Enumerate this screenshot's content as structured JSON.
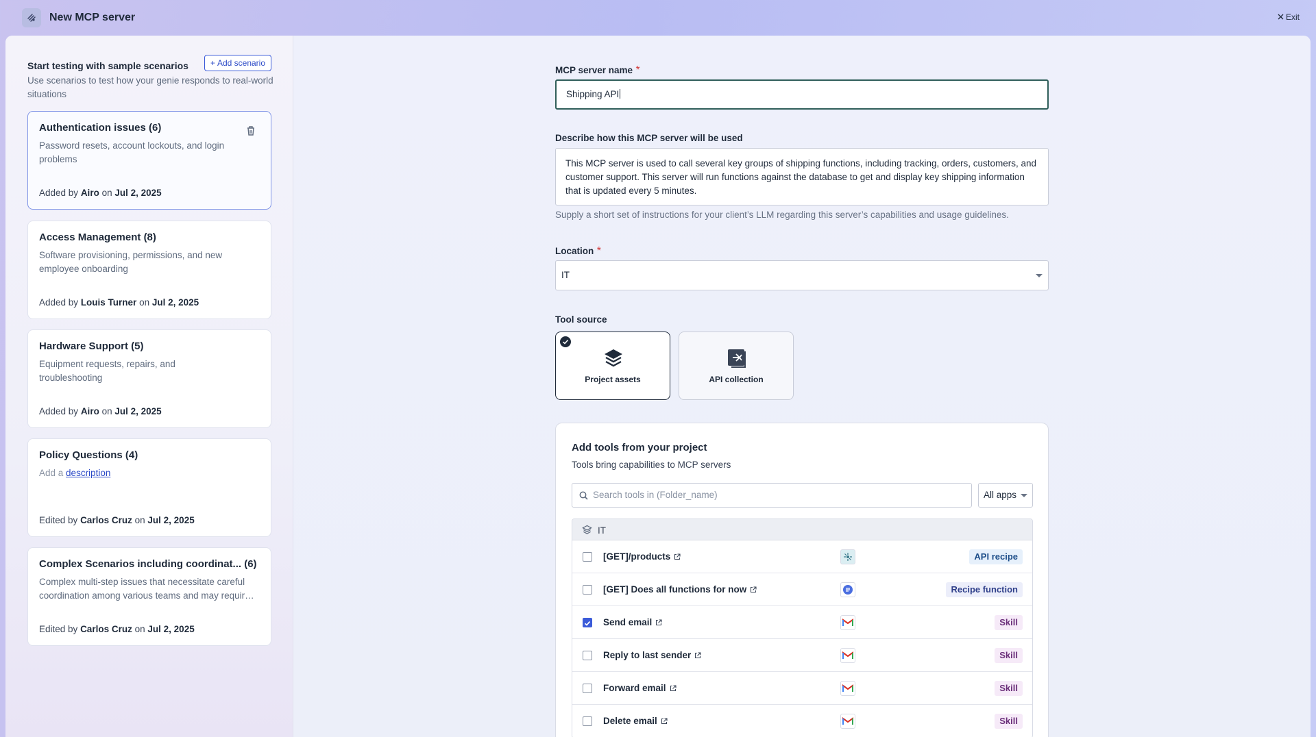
{
  "header": {
    "title": "New MCP server",
    "exit_label": "Exit"
  },
  "sidebar": {
    "title": "Start testing with sample scenarios",
    "add_label": "Add scenario",
    "subtitle": "Use scenarios to test how your genie responds to real-world situations",
    "cards": [
      {
        "title": "Authentication issues (6)",
        "desc": "Password resets, account lockouts, and login problems",
        "verb": "Added by",
        "author": "Airo",
        "on": "on",
        "date": "Jul 2, 2025"
      },
      {
        "title": "Access Management (8)",
        "desc": "Software provisioning, permissions, and new employee onboarding",
        "verb": "Added by",
        "author": "Louis Turner",
        "on": "on",
        "date": "Jul 2, 2025"
      },
      {
        "title": "Hardware Support (5)",
        "desc": "Equipment requests, repairs, and troubleshooting",
        "verb": "Added by",
        "author": "Airo",
        "on": "on",
        "date": "Jul 2, 2025"
      },
      {
        "title": "Policy Questions (4)",
        "desc_prefix": "Add a",
        "desc_link": "description",
        "verb": "Edited by",
        "author": "Carlos Cruz",
        "on": "on",
        "date": "Jul 2, 2025"
      },
      {
        "title": "Complex Scenarios including coordinat... (6)",
        "desc": "Complex multi-step issues that necessitate careful coordination among various teams and may require e...",
        "verb": "Edited by",
        "author": "Carlos Cruz",
        "on": "on",
        "date": "Jul 2, 2025"
      }
    ]
  },
  "form": {
    "name_label": "MCP server name",
    "required_mark": "*",
    "name_value": "Shipping API",
    "desc_label": "Describe how this MCP server will be used",
    "desc_value": "This MCP server is used to call several key groups of shipping functions, including tracking, orders, customers, and customer support. This server will run functions against the database to get and display key shipping information that is updated every 5 minutes.",
    "desc_hint": "Supply a short set of instructions for your client’s LLM regarding this server’s capabilities and usage guidelines.",
    "location_label": "Location",
    "location_value": "IT",
    "tool_source_label": "Tool source",
    "tool_sources": [
      {
        "label": "Project assets",
        "selected": true,
        "icon": "layers-icon"
      },
      {
        "label": "API collection",
        "selected": false,
        "icon": "api-collection-icon"
      }
    ]
  },
  "tools": {
    "title": "Add tools from your project",
    "subtitle": "Tools bring capabilities to MCP servers",
    "search_placeholder": "Search tools in (Folder_name)",
    "filter_label": "All apps",
    "group_label": "IT",
    "rows": [
      {
        "name": "[GET]/products",
        "checked": false,
        "app": "api-platform-icon",
        "tag": "API recipe",
        "tag_kind": "recipe"
      },
      {
        "name": "[GET] Does all functions for now",
        "checked": false,
        "app": "recipe-function-icon",
        "tag": "Recipe function",
        "tag_kind": "func"
      },
      {
        "name": "Send email",
        "checked": true,
        "app": "gmail-icon",
        "tag": "Skill",
        "tag_kind": "skill"
      },
      {
        "name": "Reply to last sender",
        "checked": false,
        "app": "gmail-icon",
        "tag": "Skill",
        "tag_kind": "skill"
      },
      {
        "name": "Forward email",
        "checked": false,
        "app": "gmail-icon",
        "tag": "Skill",
        "tag_kind": "skill"
      },
      {
        "name": "Delete email",
        "checked": false,
        "app": "gmail-icon",
        "tag": "Skill",
        "tag_kind": "skill"
      }
    ]
  },
  "colors": {
    "accent": "#3b5bd9",
    "focus_border": "#2f5e59",
    "required": "#d23b3b"
  }
}
